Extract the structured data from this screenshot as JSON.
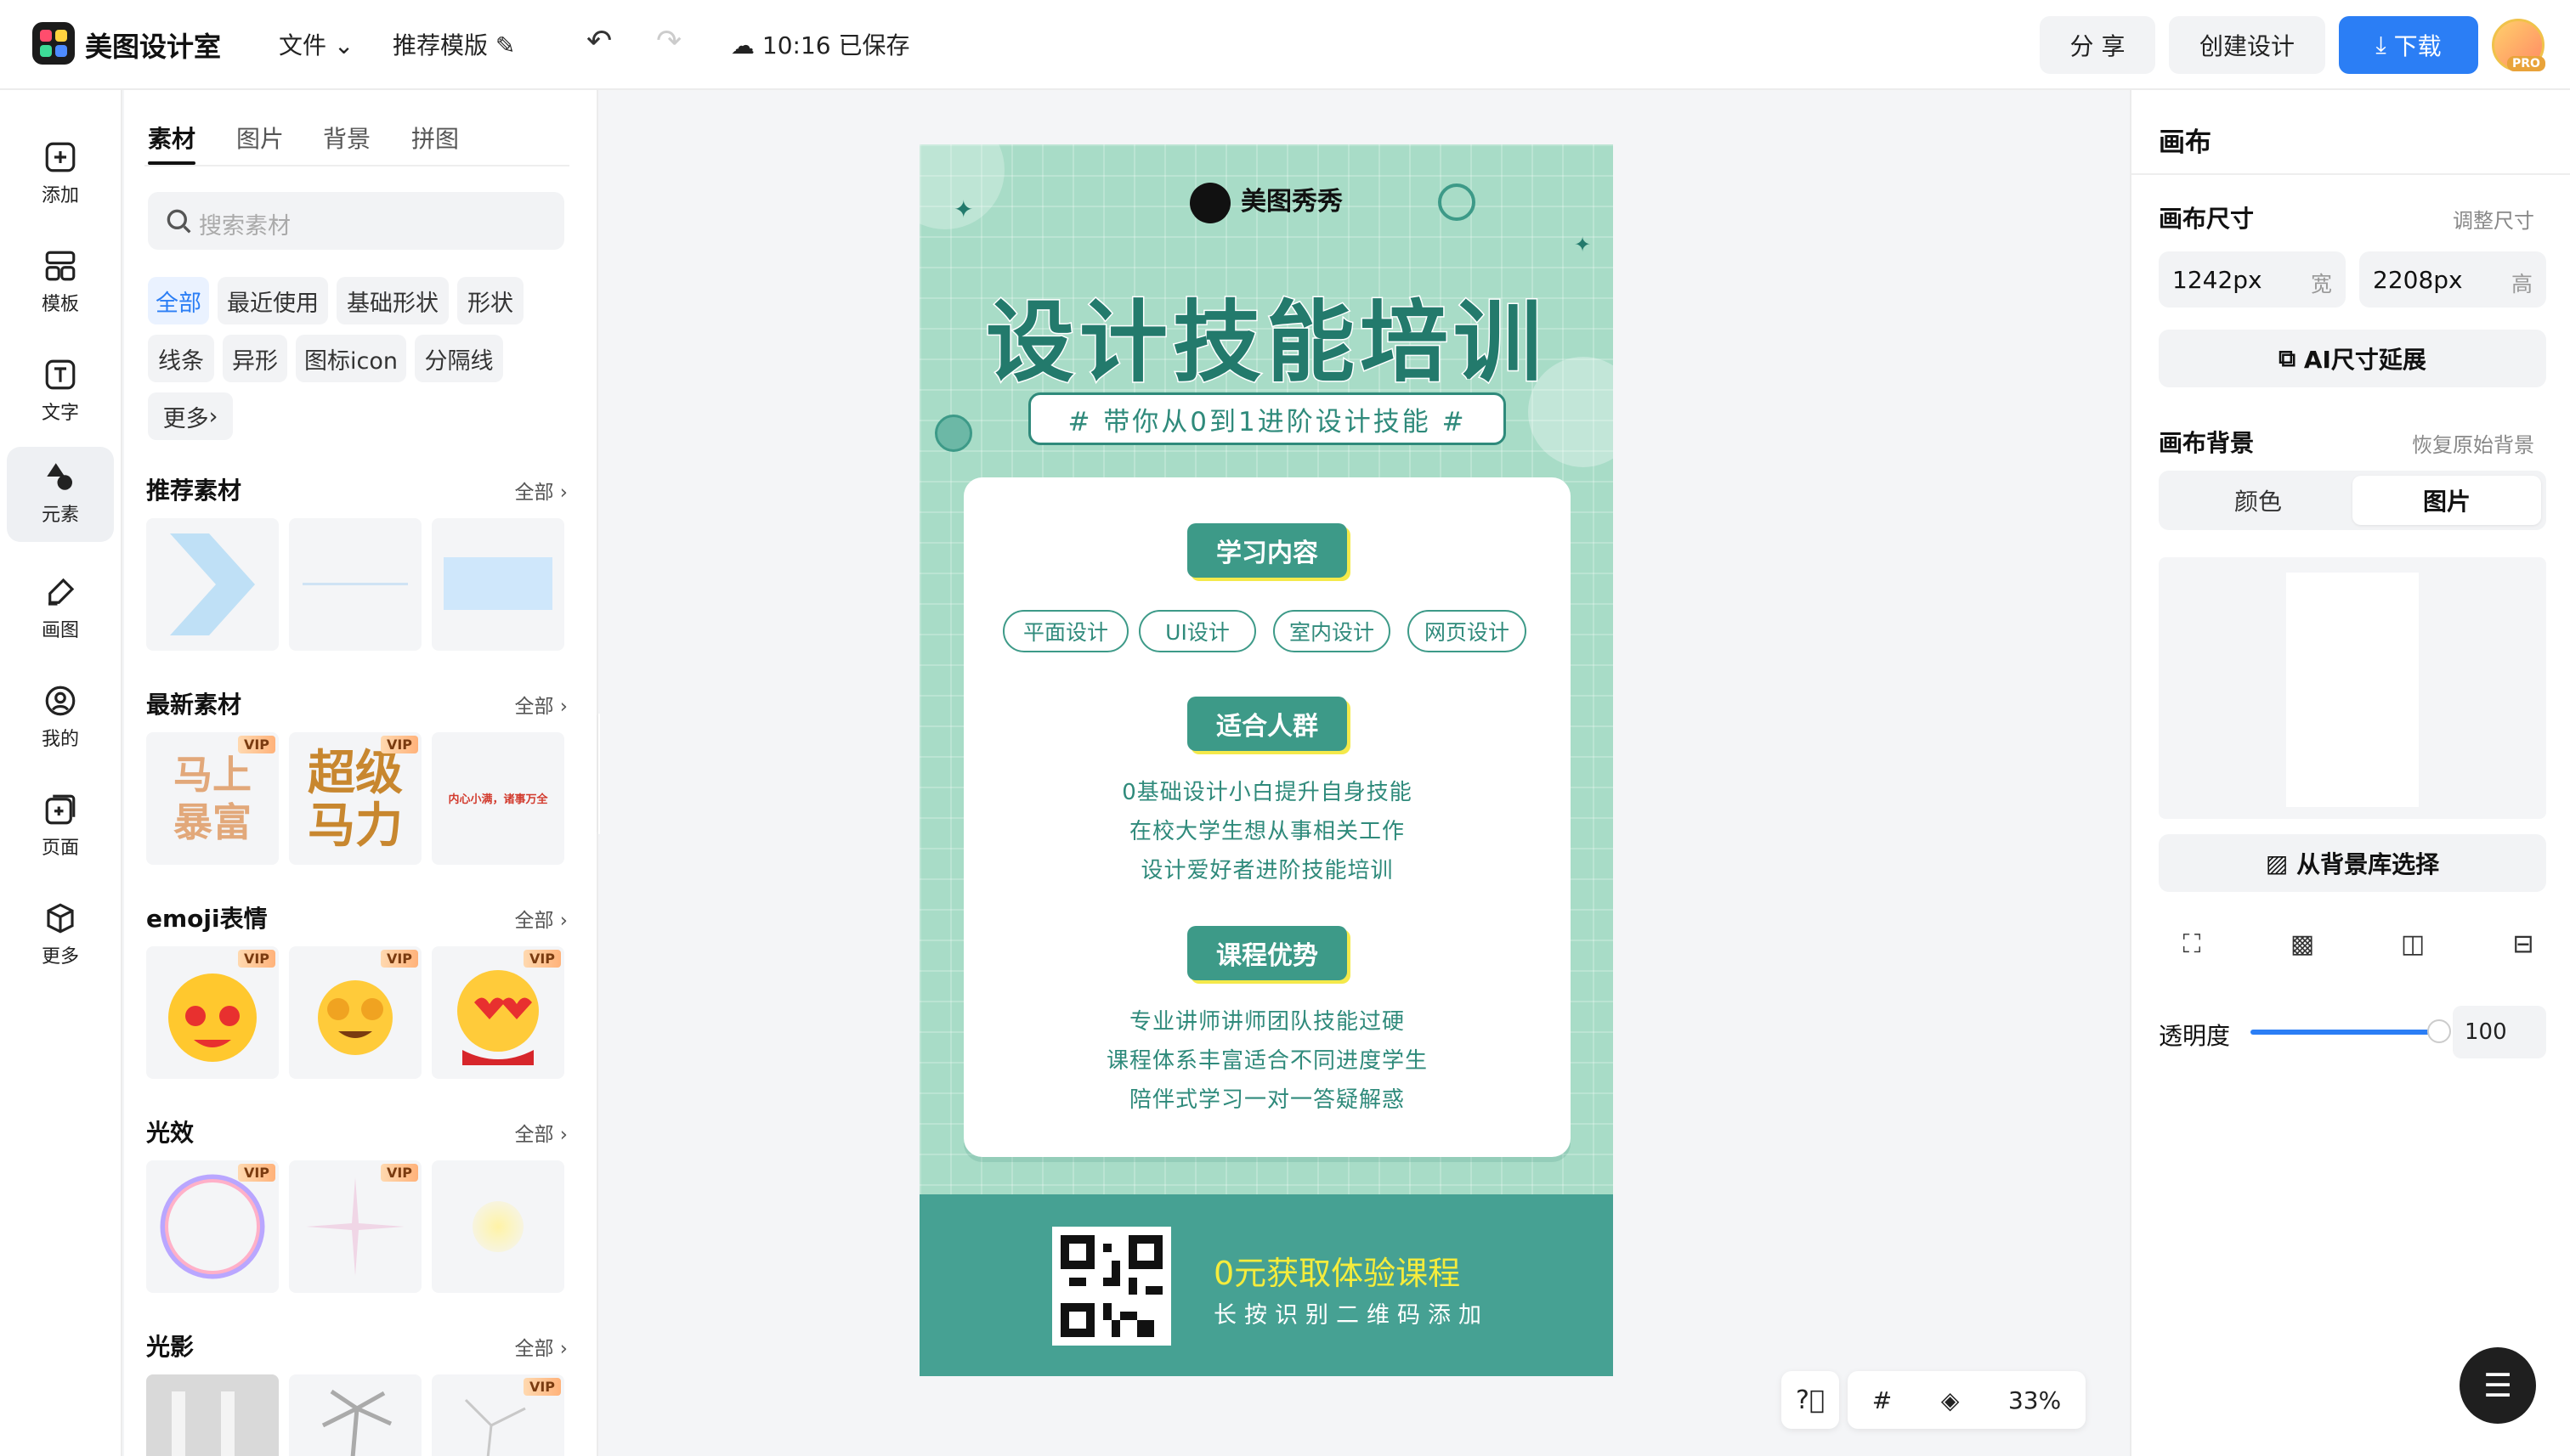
{
  "app": {
    "name": "美图设计室"
  },
  "topbar": {
    "file_menu": "文件",
    "recommend_template": "推荐模版",
    "save_status": "10:16 已保存",
    "share": "分 享",
    "create_design": "创建设计",
    "download": "下载",
    "pro_badge": "PRO"
  },
  "leftnav": {
    "items": [
      {
        "label": "添加",
        "icon": "plus-square-icon"
      },
      {
        "label": "模板",
        "icon": "template-icon"
      },
      {
        "label": "文字",
        "icon": "text-icon"
      },
      {
        "label": "元素",
        "icon": "shapes-icon",
        "active": true
      },
      {
        "label": "画图",
        "icon": "draw-icon"
      },
      {
        "label": "我的",
        "icon": "user-icon"
      },
      {
        "label": "页面",
        "icon": "page-add-icon"
      },
      {
        "label": "更多",
        "icon": "box-icon"
      }
    ]
  },
  "panel": {
    "tabs": [
      "素材",
      "图片",
      "背景",
      "拼图"
    ],
    "active_tab": "素材",
    "search_placeholder": "搜索素材",
    "chips": [
      "全部",
      "最近使用",
      "基础形状",
      "形状",
      "线条",
      "异形",
      "图标icon",
      "分隔线",
      "更多"
    ],
    "all_label": "全部",
    "sections": [
      {
        "title": "推荐素材"
      },
      {
        "title": "最新素材",
        "thumb1_text": "马上暴富",
        "thumb2_text": "超级马力",
        "thumb3_text": "内心小满，诸事万全"
      },
      {
        "title": "emoji表情"
      },
      {
        "title": "光效"
      },
      {
        "title": "光影"
      }
    ],
    "vip": "VIP"
  },
  "poster": {
    "brand": "美图秀秀",
    "title": "设计技能培训",
    "subtitle": "# 带你从0到1进阶设计技能 #",
    "section1_badge": "学习内容",
    "pills": [
      "平面设计",
      "UI设计",
      "室内设计",
      "网页设计"
    ],
    "section2_badge": "适合人群",
    "audience": [
      "0基础设计小白提升自身技能",
      "在校大学生想从事相关工作",
      "设计爱好者进阶技能培训"
    ],
    "section3_badge": "课程优势",
    "advantages": [
      "专业讲师讲师团队技能过硬",
      "课程体系丰富适合不同进度学生",
      "陪伴式学习一对一答疑解惑"
    ],
    "footer_title": "0元获取体验课程",
    "footer_sub": "长按识别二维码添加",
    "colors": {
      "bg": "#a8dcc7",
      "accent": "#3d9a88",
      "title": "#237a6c",
      "highlight": "#f5ec3c"
    }
  },
  "zoom": {
    "level": "33%"
  },
  "rightpanel": {
    "title": "画布",
    "canvas_size_label": "画布尺寸",
    "resize_link": "调整尺寸",
    "width_value": "1242px",
    "width_unit": "宽",
    "height_value": "2208px",
    "height_unit": "高",
    "ai_extend": "AI尺寸延展",
    "bg_label": "画布背景",
    "restore_bg": "恢复原始背景",
    "seg_color": "颜色",
    "seg_image": "图片",
    "from_library": "从背景库选择",
    "opacity_label": "透明度",
    "opacity_value": "100"
  },
  "colors": {
    "accent": "#2b7ef5"
  }
}
